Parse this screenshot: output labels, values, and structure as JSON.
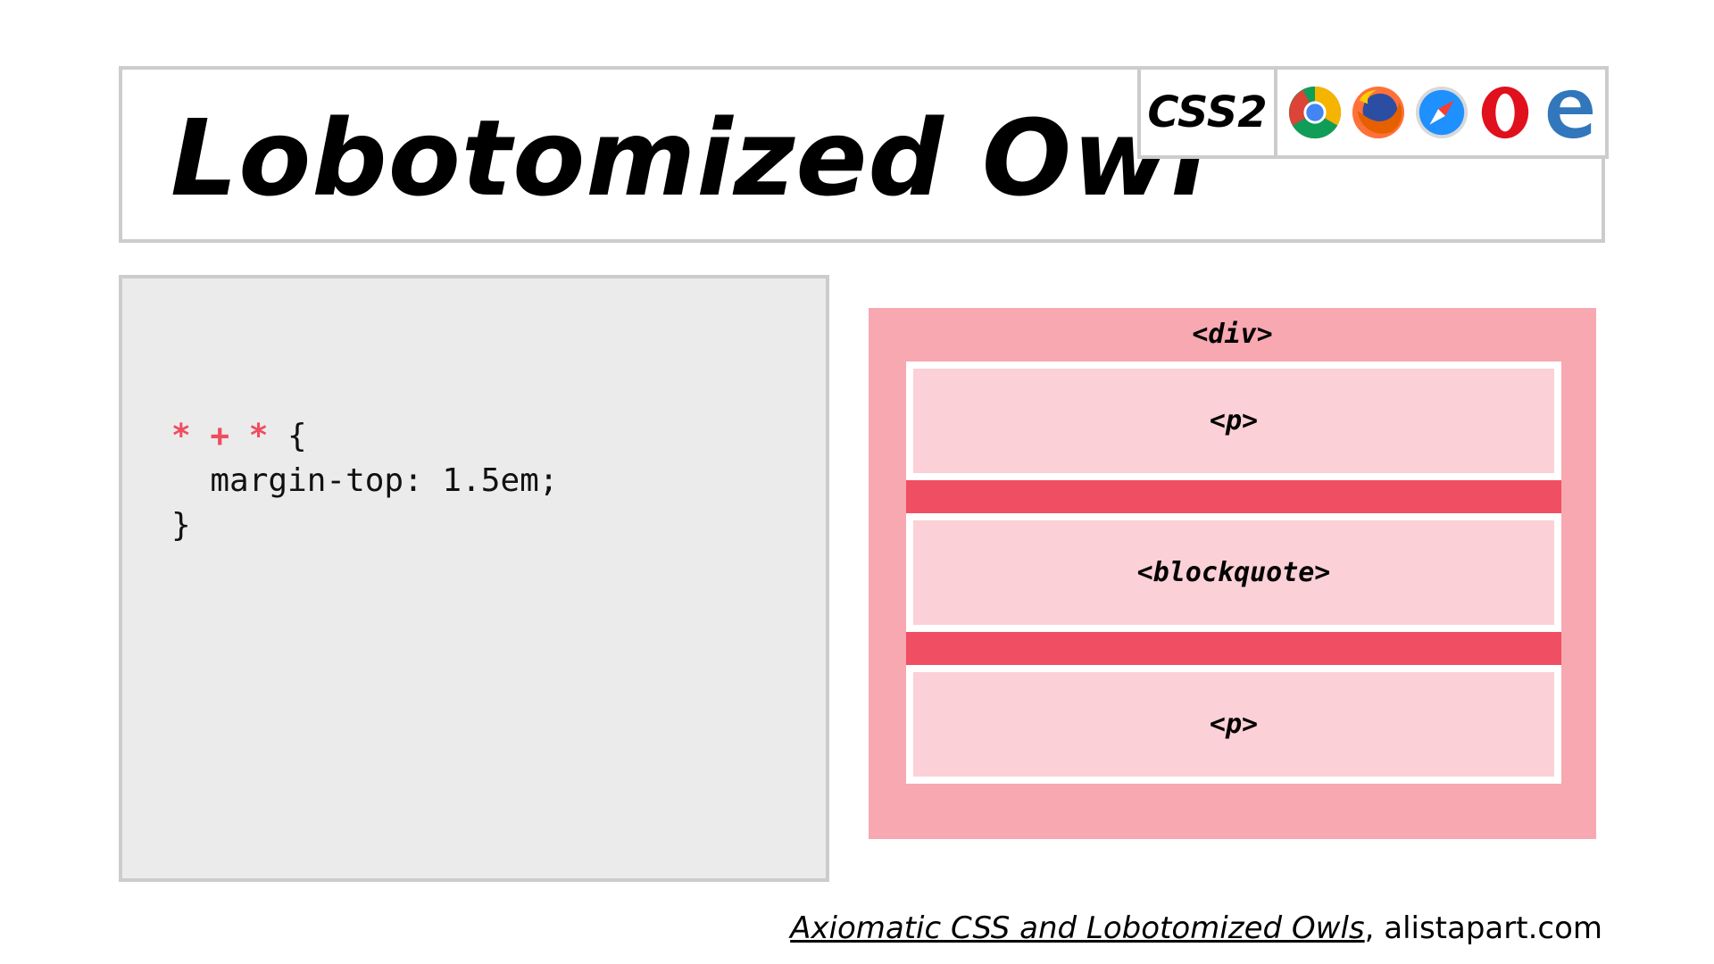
{
  "title": "Lobotomized Owl",
  "badge": {
    "label": "CSS2"
  },
  "browsers": [
    {
      "name": "Chrome",
      "icon": "chrome-icon"
    },
    {
      "name": "Firefox",
      "icon": "firefox-icon"
    },
    {
      "name": "Safari",
      "icon": "safari-icon"
    },
    {
      "name": "Opera",
      "icon": "opera-icon"
    },
    {
      "name": "Edge",
      "icon": "edge-icon"
    }
  ],
  "code": {
    "selector": "* + *",
    "open_brace": " {",
    "declaration": "  margin-top: 1.5em;",
    "close_brace": "}"
  },
  "diagram": {
    "parent_label": "<div>",
    "children": [
      "<p>",
      "<blockquote>",
      "<p>"
    ]
  },
  "footer": {
    "link_text": "Axiomatic CSS and Lobotomized Owls",
    "source": ", alistapart.com"
  },
  "colors": {
    "accent": "#ef4d60",
    "parent_bg": "#f7a8b1",
    "child_bg": "#fbd0d6",
    "margin": "#f04e62",
    "panel_bg": "#ebebeb",
    "border": "#cccccc"
  }
}
